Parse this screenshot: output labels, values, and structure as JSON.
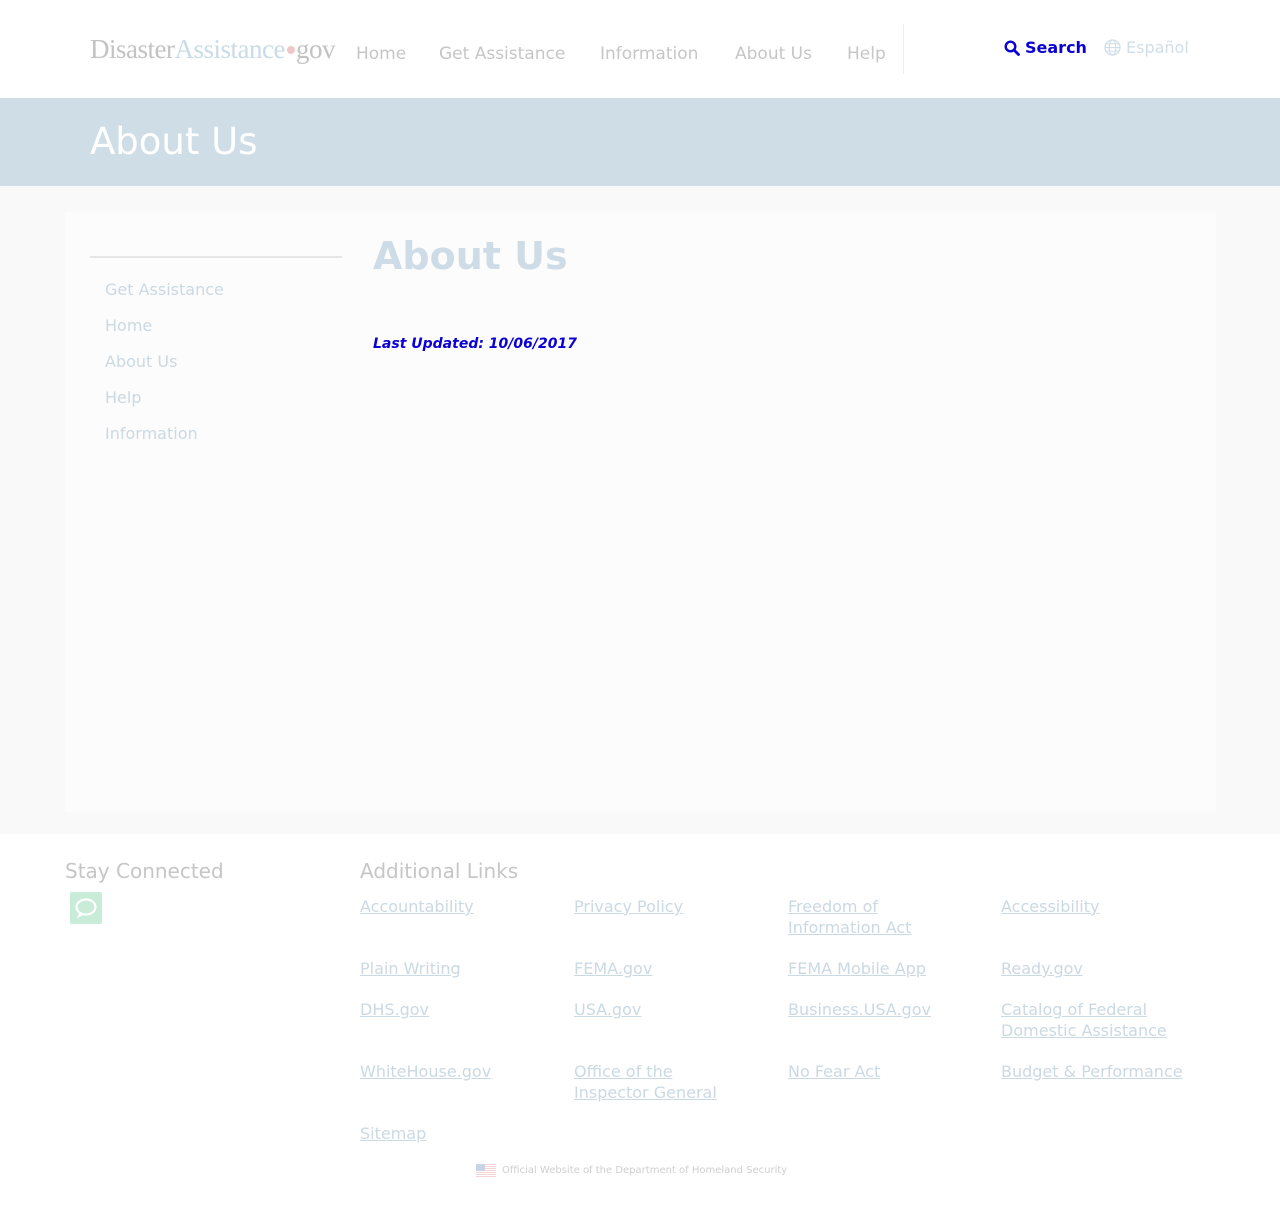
{
  "header": {
    "logo": {
      "part1": "Disaster",
      "part2": "Assistance",
      "part3": "gov"
    },
    "nav": [
      {
        "label": "Home"
      },
      {
        "label": "Get Assistance"
      },
      {
        "label": "Information"
      },
      {
        "label": "About Us"
      },
      {
        "label": "Help"
      }
    ],
    "search_label": "Search",
    "language_label": "Español"
  },
  "banner": {
    "title": "About Us"
  },
  "sidebar": {
    "items": [
      {
        "label": "Get Assistance"
      },
      {
        "label": "Home"
      },
      {
        "label": "About Us"
      },
      {
        "label": "Help"
      },
      {
        "label": "Information"
      }
    ]
  },
  "main": {
    "title": "About Us",
    "last_updated": "Last Updated: 10/06/2017"
  },
  "footer": {
    "stay_connected": "Stay Connected",
    "additional_links_title": "Additional Links",
    "links": [
      [
        "Accountability"
      ],
      [
        "Privacy Policy"
      ],
      [
        "Freedom of",
        "Information Act"
      ],
      [
        "Accessibility"
      ],
      [
        "Plain Writing"
      ],
      [
        "FEMA.gov"
      ],
      [
        "FEMA Mobile App"
      ],
      [
        "Ready.gov"
      ],
      [
        "DHS.gov"
      ],
      [
        "USA.gov"
      ],
      [
        "Business.USA.gov"
      ],
      [
        "Catalog of Federal",
        "Domestic Assistance"
      ],
      [
        "WhiteHouse.gov"
      ],
      [
        "Office of the",
        "Inspector General"
      ],
      [
        "No Fear Act"
      ],
      [
        "Budget & Performance"
      ],
      [
        "Sitemap"
      ]
    ],
    "official": "Official Website of the Department of Homeland Security"
  },
  "colors": {
    "accent_blue": "#0b00d4",
    "banner": "#cedde6",
    "link": "#cbd9e3",
    "chat_icon": "#c8ecd8"
  },
  "icons": [
    "search-icon",
    "globe-icon",
    "chat-icon",
    "us-flag-icon"
  ]
}
